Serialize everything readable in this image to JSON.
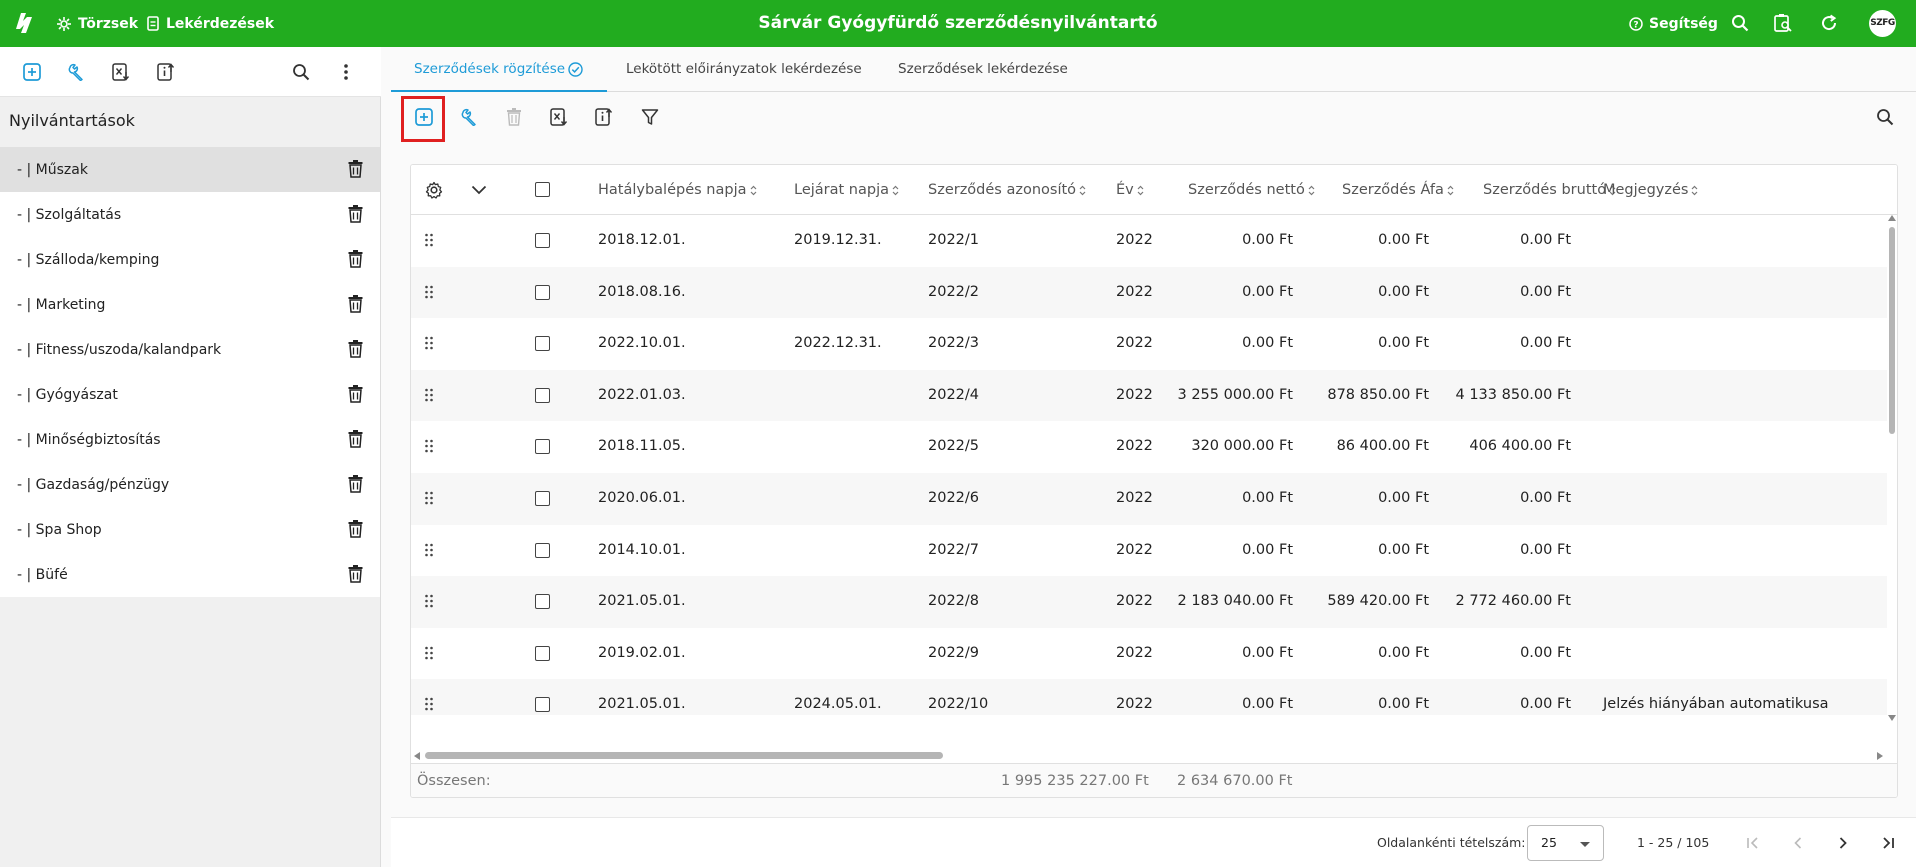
{
  "topbar": {
    "nav": [
      {
        "label": "Törzsek",
        "icon": "gear-icon"
      },
      {
        "label": "Lekérdezések",
        "icon": "document-icon"
      }
    ],
    "title": "Sárvár Gyógyfürdő szerződésnyilvántartó",
    "help_label": "Segítség",
    "avatar_text": "SZFG"
  },
  "sidebar": {
    "title": "Nyilvántartások",
    "items": [
      {
        "label": "- | Műszak",
        "selected": true
      },
      {
        "label": "- | Szolgáltatás"
      },
      {
        "label": "- | Szálloda/kemping"
      },
      {
        "label": "- | Marketing"
      },
      {
        "label": "- | Fitness/uszoda/kalandpark"
      },
      {
        "label": "- | Gyógyászat"
      },
      {
        "label": "- | Minőségbiztosítás"
      },
      {
        "label": "- | Gazdaság/pénzügy"
      },
      {
        "label": "- | Spa Shop"
      },
      {
        "label": "- | Büfé"
      }
    ]
  },
  "tabs": [
    {
      "label": "Szerződések rögzítése",
      "active": true
    },
    {
      "label": "Lekötött előirányzatok lekérdezése"
    },
    {
      "label": "Szerződések lekérdezése"
    }
  ],
  "table": {
    "columns": [
      "Hatálybalépés napja",
      "Lejárat napja",
      "Szerződés azonosító",
      "Év",
      "Szerződés nettó",
      "Szerződés Áfa",
      "Szerződés bruttó",
      "Megjegyzés"
    ],
    "rows": [
      [
        "2018.12.01.",
        "2019.12.31.",
        "2022/1",
        "2022",
        "0.00 Ft",
        "0.00 Ft",
        "0.00 Ft",
        ""
      ],
      [
        "2018.08.16.",
        "",
        "2022/2",
        "2022",
        "0.00 Ft",
        "0.00 Ft",
        "0.00 Ft",
        ""
      ],
      [
        "2022.10.01.",
        "2022.12.31.",
        "2022/3",
        "2022",
        "0.00 Ft",
        "0.00 Ft",
        "0.00 Ft",
        ""
      ],
      [
        "2022.01.03.",
        "",
        "2022/4",
        "2022",
        "3 255 000.00 Ft",
        "878 850.00 Ft",
        "4 133 850.00 Ft",
        ""
      ],
      [
        "2018.11.05.",
        "",
        "2022/5",
        "2022",
        "320 000.00 Ft",
        "86 400.00 Ft",
        "406 400.00 Ft",
        ""
      ],
      [
        "2020.06.01.",
        "",
        "2022/6",
        "2022",
        "0.00 Ft",
        "0.00 Ft",
        "0.00 Ft",
        ""
      ],
      [
        "2014.10.01.",
        "",
        "2022/7",
        "2022",
        "0.00 Ft",
        "0.00 Ft",
        "0.00 Ft",
        ""
      ],
      [
        "2021.05.01.",
        "",
        "2022/8",
        "2022",
        "2 183 040.00 Ft",
        "589 420.00 Ft",
        "2 772 460.00 Ft",
        ""
      ],
      [
        "2019.02.01.",
        "",
        "2022/9",
        "2022",
        "0.00 Ft",
        "0.00 Ft",
        "0.00 Ft",
        ""
      ],
      [
        "2021.05.01.",
        "2024.05.01.",
        "2022/10",
        "2022",
        "0.00 Ft",
        "0.00 Ft",
        "0.00 Ft",
        "Jelzés hiányában automatikusa"
      ]
    ],
    "summary": {
      "label": "Összesen:",
      "net": "1 995 235 227.00 Ft",
      "vat": "2 634 670.00 Ft"
    }
  },
  "pager": {
    "per_page_label": "Oldalankénti tételszám:",
    "per_page_value": "25",
    "range": "1 - 25 / 105"
  },
  "colors": {
    "brand": "#22ac1f",
    "accent": "#1e9bd7",
    "highlight": "#e02020"
  }
}
